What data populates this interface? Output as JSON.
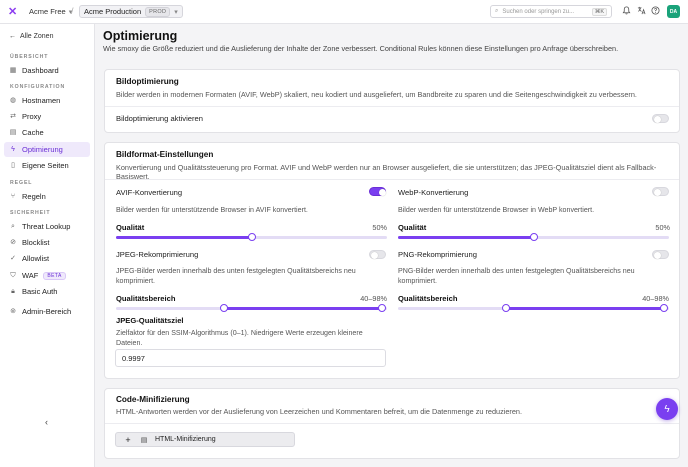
{
  "topbar": {
    "team": "Acme Free",
    "zone": "Acme Production",
    "zone_badge": "PROD",
    "search_placeholder": "Suchen oder springen zu...",
    "search_shortcut": "⌘K",
    "avatar_initials": "DA",
    "icons": [
      "bell-icon",
      "translate-icon",
      "help-icon"
    ]
  },
  "sidebar": {
    "back": "Alle Zonen",
    "sections": [
      {
        "label": "ÜBERSICHT",
        "items": [
          {
            "label": "Dashboard",
            "icon": "dashboard-icon"
          }
        ]
      },
      {
        "label": "KONFIGURATION",
        "items": [
          {
            "label": "Hostnamen",
            "icon": "globe-icon"
          },
          {
            "label": "Proxy",
            "icon": "proxy-icon"
          },
          {
            "label": "Cache",
            "icon": "database-icon"
          },
          {
            "label": "Optimierung",
            "icon": "zap-icon",
            "active": true
          },
          {
            "label": "Eigene Seiten",
            "icon": "page-icon"
          }
        ]
      },
      {
        "label": "REGEL",
        "items": [
          {
            "label": "Regeln",
            "icon": "rules-icon"
          }
        ]
      },
      {
        "label": "SICHERHEIT",
        "items": [
          {
            "label": "Threat Lookup",
            "icon": "search-shield-icon"
          },
          {
            "label": "Blocklist",
            "icon": "ban-icon"
          },
          {
            "label": "Allowlist",
            "icon": "check-circle-icon"
          },
          {
            "label": "WAF",
            "icon": "shield-icon",
            "badge": "BETA"
          },
          {
            "label": "Basic Auth",
            "icon": "lock-icon"
          }
        ]
      },
      {
        "label": "",
        "items": [
          {
            "label": "Admin-Bereich",
            "icon": "admin-icon"
          }
        ]
      }
    ]
  },
  "page": {
    "title": "Optimierung",
    "description": "Wie smoxy die Größe reduziert und die Auslieferung der Inhalte der Zone verbessert. Conditional Rules können diese Einstellungen pro Anfrage überschreiben."
  },
  "image_opt": {
    "title": "Bildoptimierung",
    "description": "Bilder werden in modernen Formaten (AVIF, WebP) skaliert, neu kodiert und ausgeliefert, um Bandbreite zu sparen und die Seitengeschwindigkeit zu verbessern.",
    "toggle_label": "Bildoptimierung aktivieren",
    "enabled": false
  },
  "format": {
    "title": "Bildformat-Einstellungen",
    "description": "Konvertierung und Qualitätssteuerung pro Format. AVIF und WebP werden nur an Browser ausgeliefert, die sie unterstützen; das JPEG-Qualitätsziel dient als Fallback-Basiswert.",
    "avif": {
      "label": "AVIF-Konvertierung",
      "enabled": true,
      "sub": "Bilder werden für unterstützende Browser in AVIF konvertiert.",
      "quality_label": "Qualität",
      "quality": "50%",
      "quality_value": 0.5
    },
    "webp": {
      "label": "WebP-Konvertierung",
      "enabled": false,
      "sub": "Bilder werden für unterstützende Browser in WebP konvertiert.",
      "quality_label": "Qualität",
      "quality": "50%",
      "quality_value": 0.5
    },
    "jpeg": {
      "label": "JPEG-Rekomprimierung",
      "enabled": false,
      "sub": "JPEG-Bilder werden innerhalb des unten festgelegten Qualitätsbereichs neu komprimiert.",
      "range_label": "Qualitätsbereich",
      "range": "40–98%",
      "range_min": 40,
      "range_max": 98
    },
    "png": {
      "label": "PNG-Rekomprimierung",
      "enabled": false,
      "sub": "PNG-Bilder werden innerhalb des unten festgelegten Qualitätsbereichs neu komprimiert.",
      "range_label": "Qualitätsbereich",
      "range": "40–98%",
      "range_min": 40,
      "range_max": 98
    },
    "jpeg_target": {
      "label": "JPEG-Qualitätsziel",
      "sub": "Zielfaktor für den SSIM-Algorithmus (0–1). Niedrigere Werte erzeugen kleinere Dateien.",
      "value": "0.9997"
    }
  },
  "code_min": {
    "title": "Code-Minifizierung",
    "description": "HTML-Antworten werden vor der Auslieferung von Leerzeichen und Kommentaren befreit, um die Datenmenge zu reduzieren.",
    "button": "HTML-Minifizierung"
  },
  "colors": {
    "accent": "#7a3ff0",
    "active_bg": "#efe9fb",
    "avatar": "#1aa37a"
  }
}
